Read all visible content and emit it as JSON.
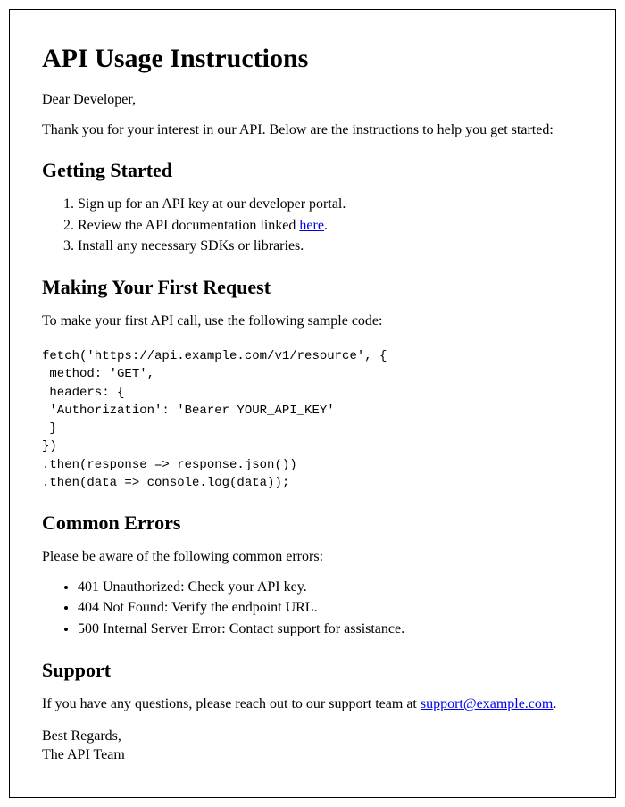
{
  "title": "API Usage Instructions",
  "greeting": "Dear Developer,",
  "intro": "Thank you for your interest in our API. Below are the instructions to help you get started:",
  "sections": {
    "getting_started": {
      "heading": "Getting Started",
      "items": [
        {
          "prefix": "Sign up for an API key at our developer portal."
        },
        {
          "prefix": "Review the API documentation linked ",
          "link": "here",
          "suffix": "."
        },
        {
          "prefix": "Install any necessary SDKs or libraries."
        }
      ]
    },
    "first_request": {
      "heading": "Making Your First Request",
      "intro": "To make your first API call, use the following sample code:",
      "code": "fetch('https://api.example.com/v1/resource', {\n method: 'GET',\n headers: {\n 'Authorization': 'Bearer YOUR_API_KEY'\n }\n})\n.then(response => response.json())\n.then(data => console.log(data));"
    },
    "common_errors": {
      "heading": "Common Errors",
      "intro": "Please be aware of the following common errors:",
      "items": [
        "401 Unauthorized: Check your API key.",
        "404 Not Found: Verify the endpoint URL.",
        "500 Internal Server Error: Contact support for assistance."
      ]
    },
    "support": {
      "heading": "Support",
      "text_prefix": "If you have any questions, please reach out to our support team at ",
      "email": "support@example.com",
      "text_suffix": "."
    }
  },
  "signoff": {
    "line1": "Best Regards,",
    "line2": "The API Team"
  }
}
